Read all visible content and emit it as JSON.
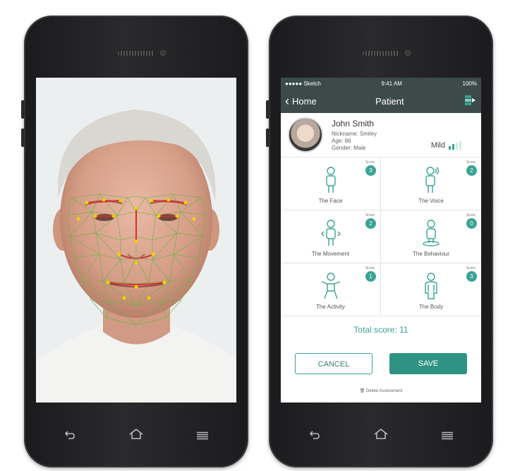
{
  "colors": {
    "accent": "#3aa394",
    "bar": "#3c4a4a"
  },
  "left_phone": {
    "nav": {
      "back_icon": "back-arrow-icon",
      "home_icon": "home-icon",
      "menu_icon": "menu-lines-icon"
    }
  },
  "right_phone": {
    "status": {
      "carrier": "●●●●● Sketch",
      "time": "9:41 AM",
      "battery": "100%"
    },
    "appbar": {
      "back_label": "Home",
      "title": "Patient"
    },
    "patient": {
      "name": "John Smith",
      "nickname": "Nickname: Smiley",
      "age": "Age: 86",
      "gender": "Gender: Male",
      "severity": "Mild"
    },
    "score_label": "Score",
    "cells": [
      {
        "label": "The Face",
        "score": "3",
        "icon": "face-person-icon"
      },
      {
        "label": "The Voice",
        "score": "2",
        "icon": "voice-person-icon"
      },
      {
        "label": "The Movement",
        "score": "2",
        "icon": "movement-person-icon"
      },
      {
        "label": "The Behaviour",
        "score": "0",
        "icon": "behaviour-person-icon"
      },
      {
        "label": "The Activity",
        "score": "1",
        "icon": "activity-person-icon"
      },
      {
        "label": "The Body",
        "score": "3",
        "icon": "body-person-icon"
      }
    ],
    "total": "Total score: 11",
    "cancel_label": "CANCEL",
    "save_label": "SAVE",
    "delete_label": "Delete Assessment"
  }
}
